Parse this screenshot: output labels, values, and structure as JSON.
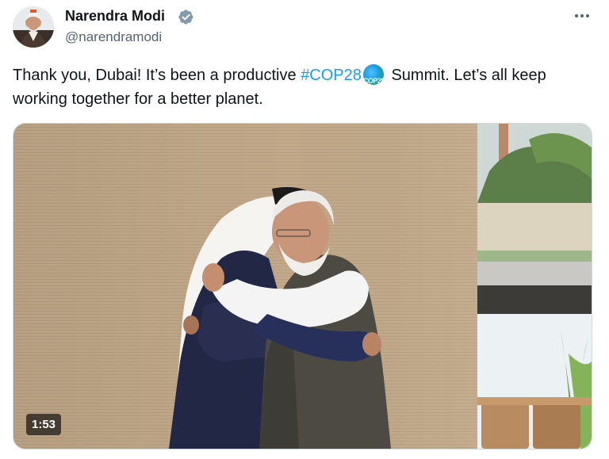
{
  "tweet": {
    "author_name": "Narendra Modi",
    "handle": "@narendramodi",
    "verified_icon": "verified-badge-icon",
    "more_icon": "more-options-icon",
    "text_before": "Thank you, Dubai! It’s been a productive ",
    "hashtag": "#COP28",
    "emoji_label": "COP28",
    "text_after": " Summit. Let’s all keep working together for a better planet.",
    "video_duration": "1:53"
  },
  "colors": {
    "link": "#1d9bf0",
    "verified": "#829aab",
    "text": "#0f1419",
    "secondary_text": "#536471"
  }
}
